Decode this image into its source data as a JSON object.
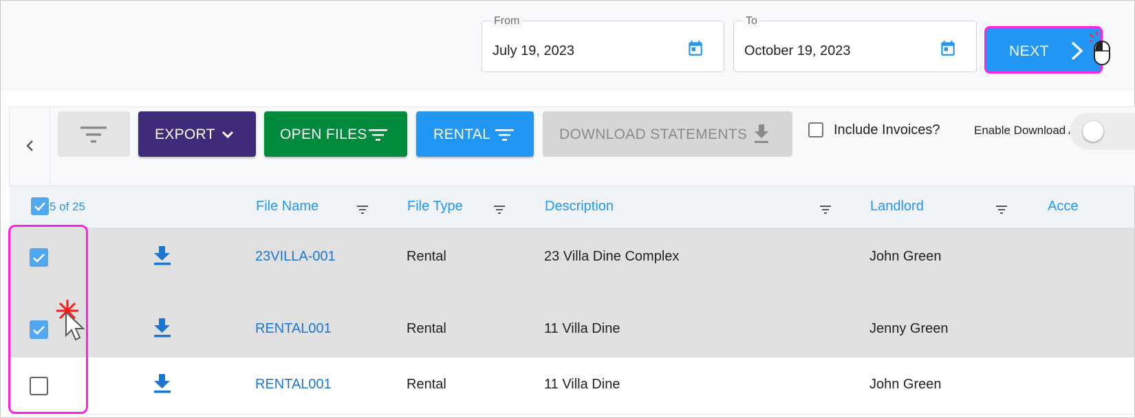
{
  "date_range": {
    "from_label": "From",
    "from_value": "July 19, 2023",
    "to_label": "To",
    "to_value": "October 19, 2023",
    "next_label": "NEXT"
  },
  "toolbar": {
    "export_label": "EXPORT",
    "open_files_label": "OPEN FILES",
    "rental_label": "RENTAL",
    "download_statements_label": "DOWNLOAD STATEMENTS",
    "include_invoices_label": "Include Invoices?",
    "include_invoices_checked": false,
    "enable_download_all_label": "Enable Download All",
    "enable_download_all_on": false
  },
  "table": {
    "selection_count": "5 of 25",
    "columns": [
      "File Name",
      "File Type",
      "Description",
      "Landlord",
      "Acce"
    ],
    "rows": [
      {
        "selected": true,
        "file_name": "23VILLA-001",
        "file_type": "Rental",
        "description": "23 Villa Dine Complex",
        "landlord": "John Green"
      },
      {
        "selected": true,
        "file_name": "RENTAL001",
        "file_type": "Rental",
        "description": "11 Villa Dine",
        "landlord": "Jenny Green"
      },
      {
        "selected": false,
        "file_name": "RENTAL001",
        "file_type": "Rental",
        "description": "11 Villa Dine",
        "landlord": "John Green"
      }
    ]
  },
  "colors": {
    "primary": "#2196f3",
    "export": "#3f2b7a",
    "open_files": "#008a3c",
    "disabled": "#d6d6d6",
    "highlight": "#ff22e0"
  },
  "icons": [
    "calendar-icon",
    "chevron-right-icon",
    "mouse-icon",
    "chevron-left-icon",
    "filter-icon",
    "chevron-down-icon",
    "download-icon",
    "check-icon",
    "cursor-icon"
  ]
}
